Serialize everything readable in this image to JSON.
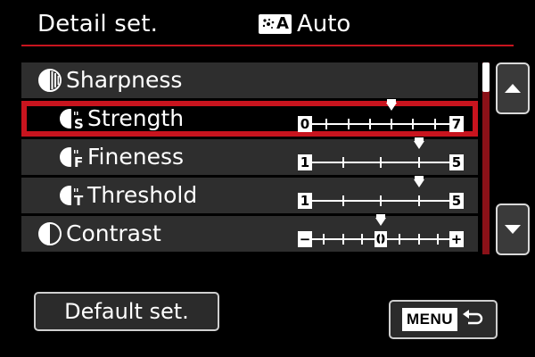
{
  "header": {
    "title": "Detail set.",
    "mode_icon_letter": "A",
    "mode_label": "Auto"
  },
  "items": [
    {
      "label": "Sharpness",
      "icon": "sharpness-icon",
      "selected": false
    },
    {
      "label": "Strength",
      "icon": "sharpness-strength-icon",
      "selected": true,
      "slider": {
        "min_label": "0",
        "max_label": "7",
        "min": 0,
        "max": 7,
        "value": 4
      }
    },
    {
      "label": "Fineness",
      "icon": "sharpness-fineness-icon",
      "selected": false,
      "slider": {
        "min_label": "1",
        "max_label": "5",
        "min": 1,
        "max": 5,
        "value": 4
      }
    },
    {
      "label": "Threshold",
      "icon": "sharpness-threshold-icon",
      "selected": false,
      "slider": {
        "min_label": "1",
        "max_label": "5",
        "min": 1,
        "max": 5,
        "value": 4
      }
    },
    {
      "label": "Contrast",
      "icon": "contrast-icon",
      "selected": false,
      "slider": {
        "min_label": "−",
        "max_label": "+",
        "center_label": "0",
        "min": -4,
        "max": 4,
        "value": 0
      }
    }
  ],
  "buttons": {
    "default_label": "Default set.",
    "menu_label": "MENU"
  },
  "icons": {
    "scroll_up": "chevron-up-icon",
    "scroll_down": "chevron-down-icon",
    "back": "return-arrow-icon"
  },
  "colors": {
    "accent": "#c8141e",
    "row_bg": "#2e2e2e",
    "background": "#000000"
  }
}
